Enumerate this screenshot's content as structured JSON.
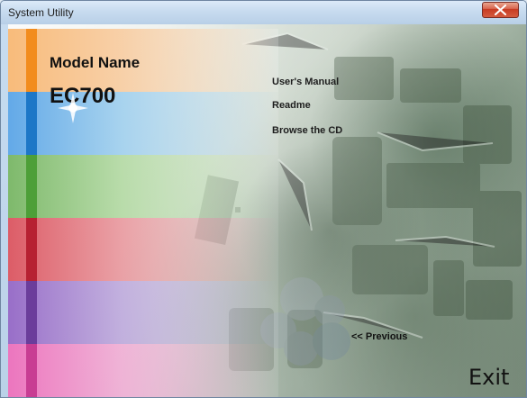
{
  "window": {
    "title": "System Utility"
  },
  "model": {
    "label": "Model Name",
    "value": "EC700"
  },
  "links": [
    "User's Manual",
    "Readme",
    "Browse the CD"
  ],
  "navigation": {
    "previous": "<< Previous",
    "exit": "Exit"
  },
  "icons": {
    "close": "close-icon",
    "sparkle": "sparkle-icon",
    "background": "circuit-board-image"
  },
  "colors": {
    "orange": "#f28c1d",
    "blue": "#1d77c7",
    "green": "#4d9f38",
    "red": "#b72132",
    "purple": "#6b3d9b",
    "pink": "#c83d93"
  }
}
